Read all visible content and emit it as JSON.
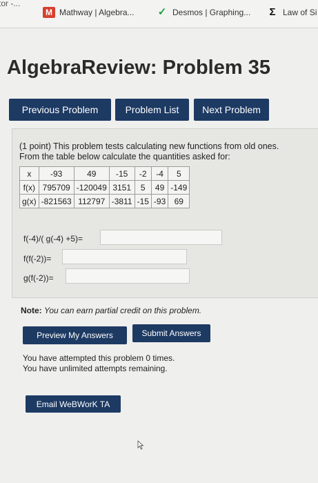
{
  "bookmarks": [
    {
      "label": "tor -...",
      "icon": ""
    },
    {
      "label": "Mathway | Algebra...",
      "icon": "mathway-icon"
    },
    {
      "label": "Desmos | Graphing...",
      "icon": "desmos-icon"
    },
    {
      "label": "Law of Si",
      "icon": "sigma-icon"
    }
  ],
  "page_title": "AlgebraReview: Problem 35",
  "nav": {
    "previous": "Previous Problem",
    "list": "Problem List",
    "next": "Next Problem"
  },
  "problem": {
    "intro_line1": "(1 point) This problem tests calculating new functions from old ones.",
    "intro_line2": "From the table below calculate the quantities asked for:",
    "table": [
      [
        "x",
        "-93",
        "49",
        "-15",
        "-2",
        "-4",
        "5"
      ],
      [
        "f(x)",
        "795709",
        "-120049",
        "3151",
        "5",
        "49",
        "-149"
      ],
      [
        "g(x)",
        "-821563",
        "112797",
        "-3811",
        "-15",
        "-93",
        "69"
      ]
    ],
    "questions": [
      {
        "label": "f(-4)/( g(-4) +5)=",
        "value": ""
      },
      {
        "label": "f(f(-2))=",
        "value": ""
      },
      {
        "label": "g(f(-2))=",
        "value": ""
      }
    ]
  },
  "note": {
    "bold": "Note:",
    "text": "You can earn partial credit on this problem."
  },
  "actions": {
    "preview": "Preview My Answers",
    "submit": "Submit Answers"
  },
  "attempts": {
    "line1": "You have attempted this problem 0 times.",
    "line2": "You have unlimited attempts remaining."
  },
  "email_button": "Email WeBWorK TA",
  "colors": {
    "button_bg": "#1d3a63",
    "mathway": "#d6402e",
    "desmos": "#1e9e43"
  }
}
